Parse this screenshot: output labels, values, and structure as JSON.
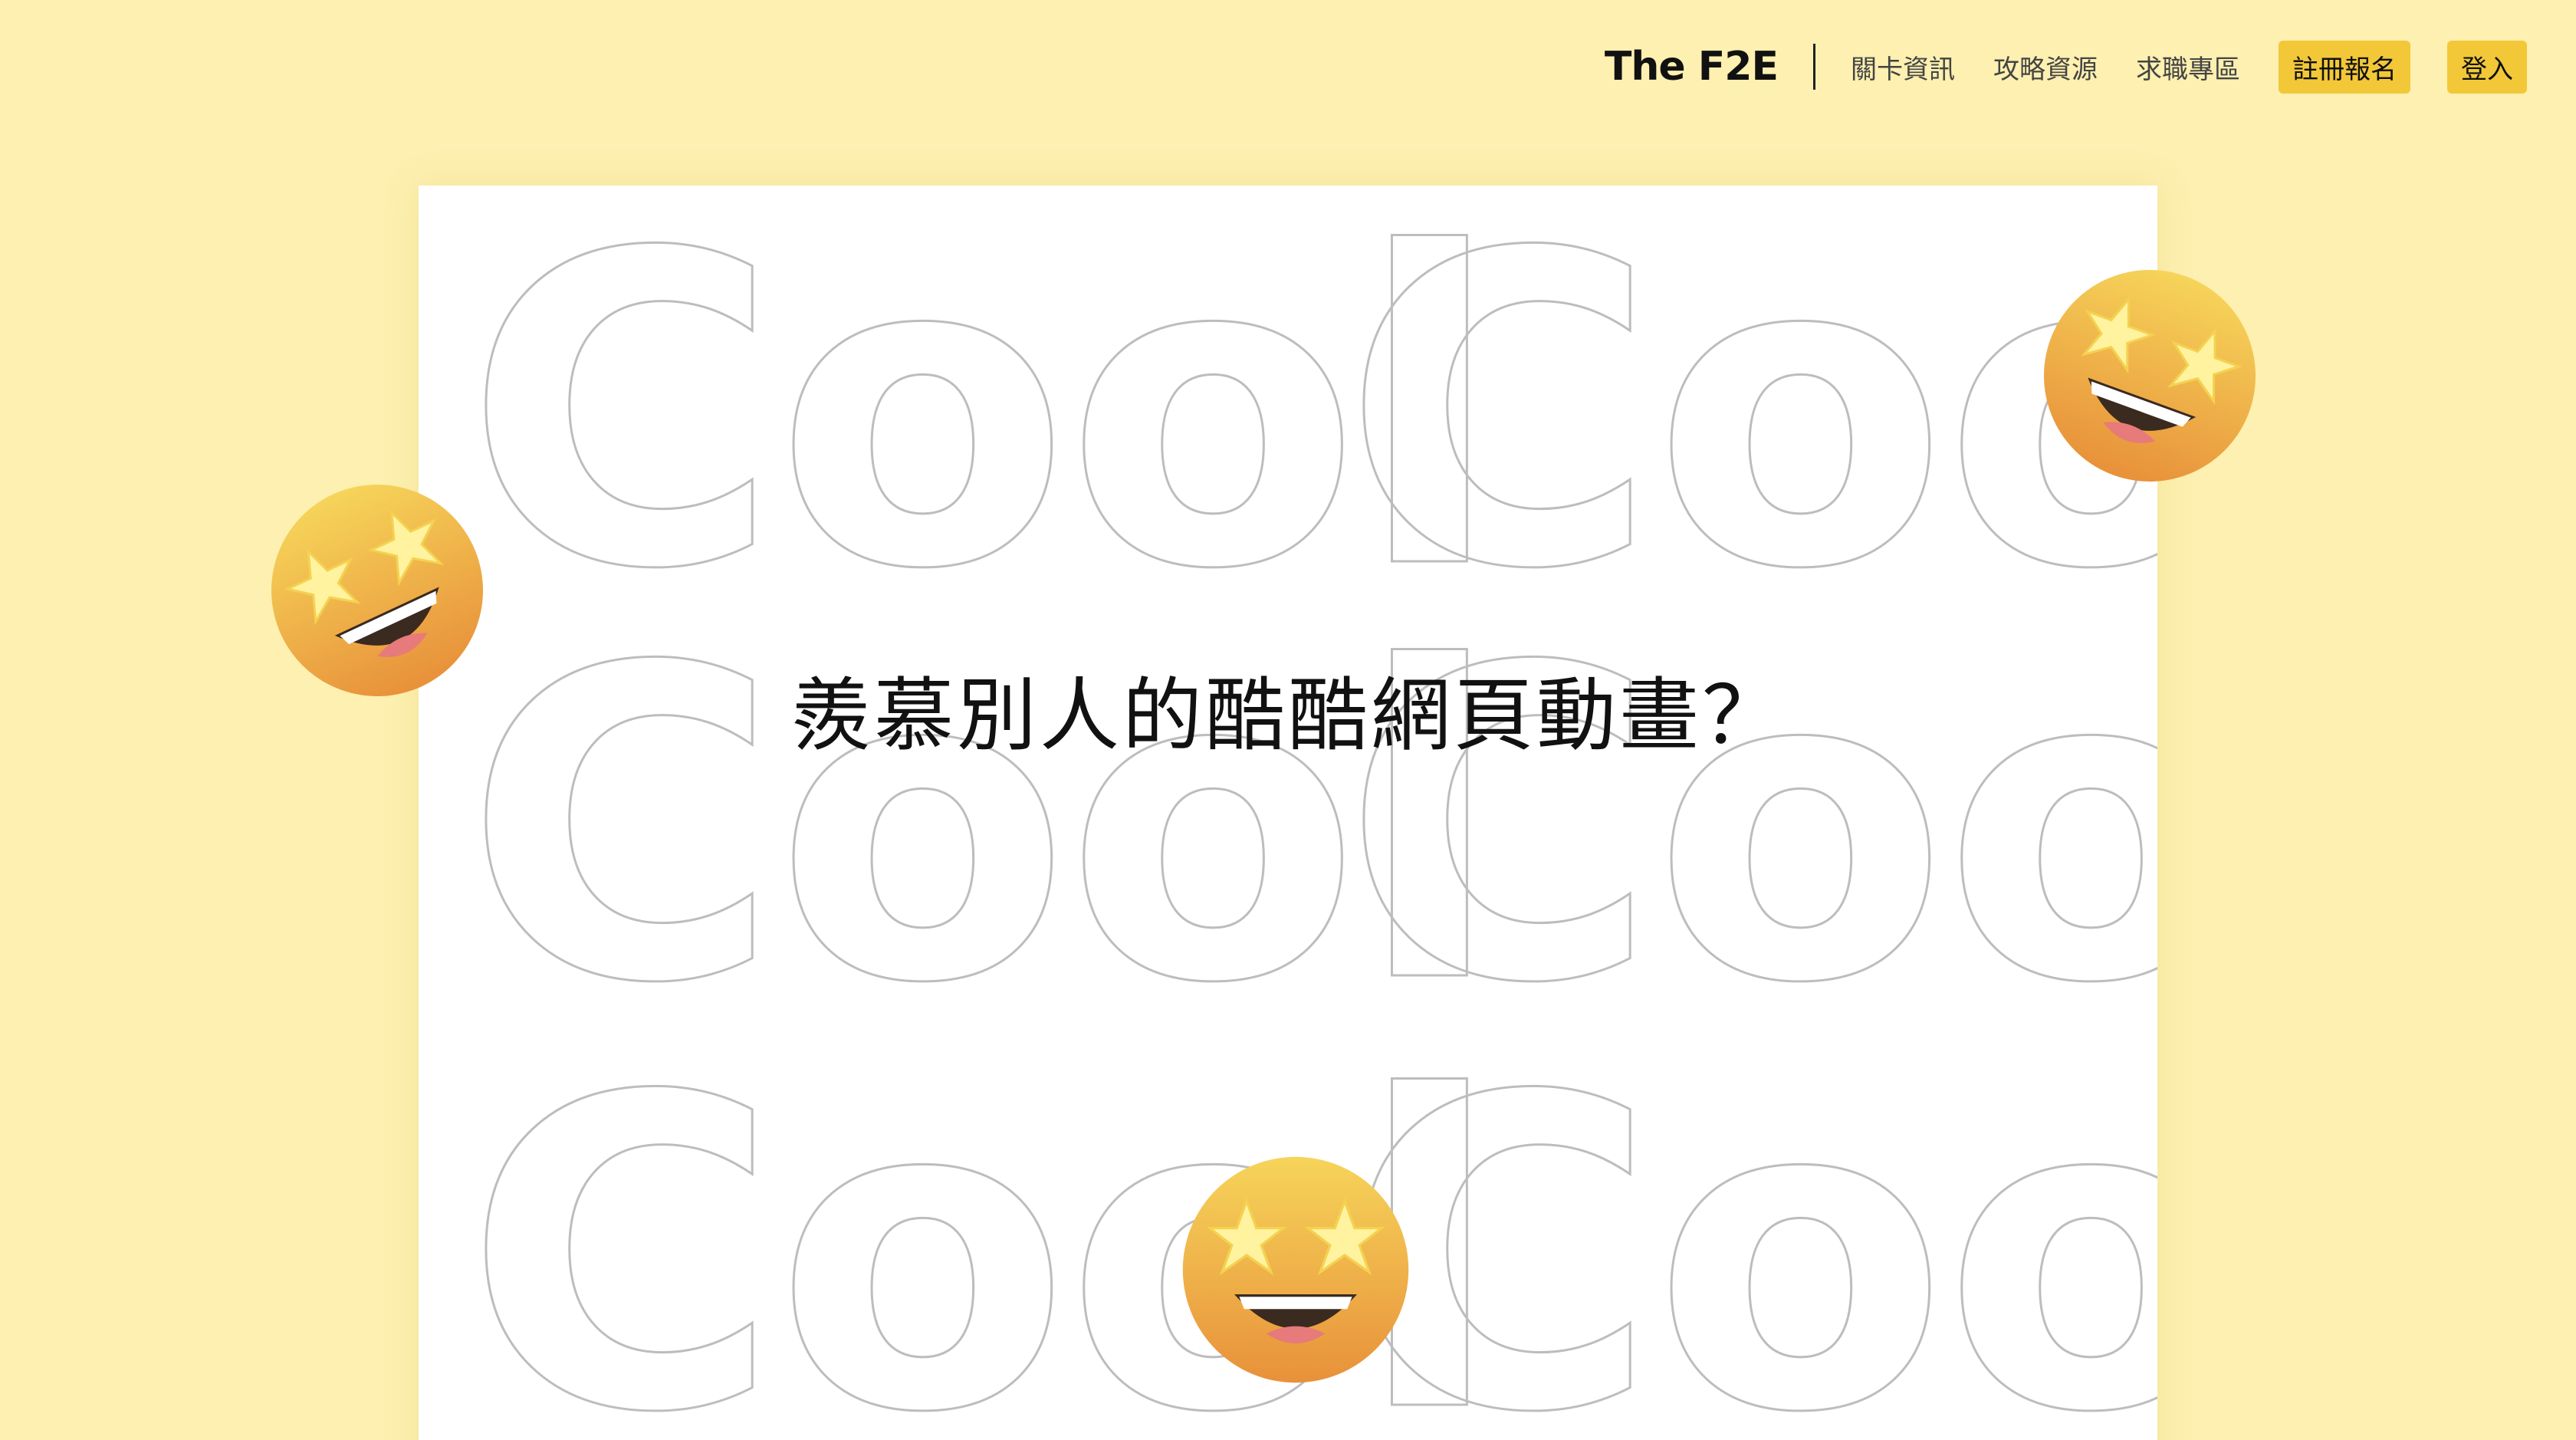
{
  "header": {
    "brand": "The F2E",
    "links": [
      "關卡資訊",
      "攻略資源",
      "求職專區"
    ],
    "register_label": "註冊報名",
    "login_label": "登入"
  },
  "hero": {
    "background_word": "Cool",
    "headline": "羨慕別人的酷酷網頁動畫？"
  },
  "colors": {
    "page_bg": "#fdf0b0",
    "button_bg": "#f2c838",
    "card_bg": "#ffffff",
    "outline_text": "#bdbdbd"
  },
  "icons": [
    "star-struck-emoji-icon",
    "star-struck-emoji-icon",
    "star-struck-emoji-icon"
  ]
}
